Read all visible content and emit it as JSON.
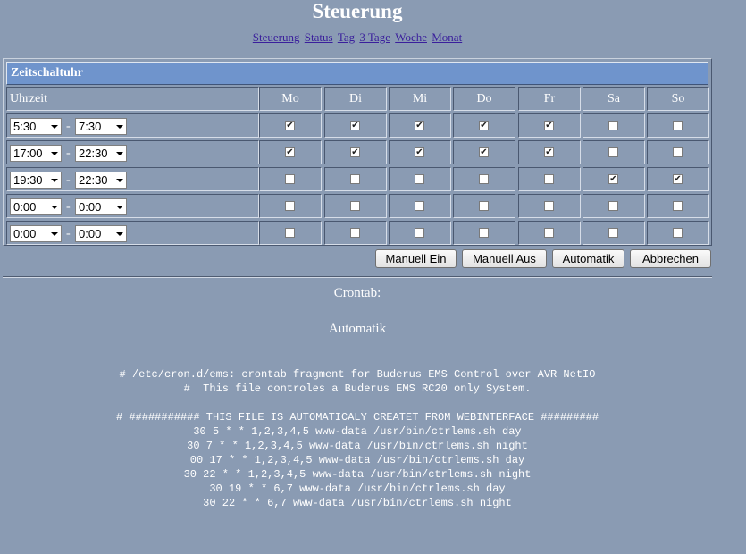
{
  "page": {
    "title": "Steuerung",
    "nav": [
      "Steuerung",
      "Status",
      "Tag",
      "3 Tage",
      "Woche",
      "Monat"
    ]
  },
  "timer": {
    "heading": "Zeitschaltuhr",
    "time_header": "Uhrzeit",
    "days": [
      "Mo",
      "Di",
      "Mi",
      "Do",
      "Fr",
      "Sa",
      "So"
    ],
    "rows": [
      {
        "start": "5:30",
        "end": "7:30",
        "checked": [
          true,
          true,
          true,
          true,
          true,
          false,
          false
        ]
      },
      {
        "start": "17:00",
        "end": "22:30",
        "checked": [
          true,
          true,
          true,
          true,
          true,
          false,
          false
        ]
      },
      {
        "start": "19:30",
        "end": "22:30",
        "checked": [
          false,
          false,
          false,
          false,
          false,
          true,
          true
        ]
      },
      {
        "start": "0:00",
        "end": "0:00",
        "checked": [
          false,
          false,
          false,
          false,
          false,
          false,
          false
        ]
      },
      {
        "start": "0:00",
        "end": "0:00",
        "checked": [
          false,
          false,
          false,
          false,
          false,
          false,
          false
        ]
      }
    ],
    "separator": "-"
  },
  "buttons": {
    "manual_on": "Manuell Ein",
    "manual_off": "Manuell Aus",
    "automatic": "Automatik",
    "cancel": "Abbrechen"
  },
  "crontab": {
    "label": "Crontab:",
    "mode": "Automatik",
    "lines": [
      "# /etc/cron.d/ems: crontab fragment for Buderus EMS Control over AVR NetIO",
      "#  This file controles a Buderus EMS RC20 only System.",
      "",
      "# ########### THIS FILE IS AUTOMATICALY CREATET FROM WEBINTERFACE #########",
      "30 5 * * 1,2,3,4,5 www-data /usr/bin/ctrlems.sh day",
      "30 7 * * 1,2,3,4,5 www-data /usr/bin/ctrlems.sh night",
      "00 17 * * 1,2,3,4,5 www-data /usr/bin/ctrlems.sh day",
      "30 22 * * 1,2,3,4,5 www-data /usr/bin/ctrlems.sh night",
      "30 19 * * 6,7 www-data /usr/bin/ctrlems.sh day",
      "30 22 * * 6,7 www-data /usr/bin/ctrlems.sh night"
    ]
  }
}
